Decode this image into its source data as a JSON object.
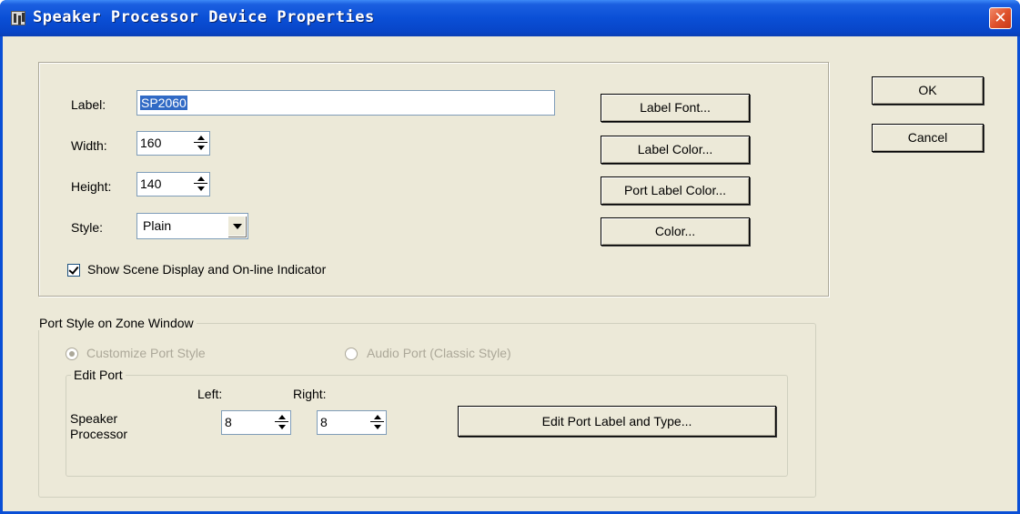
{
  "window": {
    "title": "Speaker Processor Device Properties",
    "close_symbol": "✕"
  },
  "form": {
    "label_caption": "Label:",
    "label_value": "SP2060",
    "width_caption": "Width:",
    "width_value": "160",
    "height_caption": "Height:",
    "height_value": "140",
    "style_caption": "Style:",
    "style_value": "Plain",
    "show_scene_checked": true,
    "show_scene_label": "Show Scene Display and On-line Indicator"
  },
  "appearance_buttons": {
    "label_font": "Label Font...",
    "label_color": "Label Color...",
    "port_label_color": "Port Label Color...",
    "color": "Color..."
  },
  "dialog_buttons": {
    "ok": "OK",
    "cancel": "Cancel"
  },
  "port_style": {
    "group_title": "Port Style on Zone Window",
    "customize_label": "Customize Port Style",
    "audio_port_label": "Audio Port (Classic Style)",
    "selected": "customize",
    "edit_port": {
      "group_title": "Edit Port",
      "left_caption": "Left:",
      "right_caption": "Right:",
      "row_label_line1": "Speaker",
      "row_label_line2": "Processor",
      "left_value": "8",
      "right_value": "8",
      "edit_button": "Edit Port Label and Type..."
    }
  },
  "colors": {
    "titlebar": "#0a4fd6",
    "dialog_bg": "#ece9d8",
    "selection": "#316ac5",
    "close_button": "#e0522c"
  }
}
